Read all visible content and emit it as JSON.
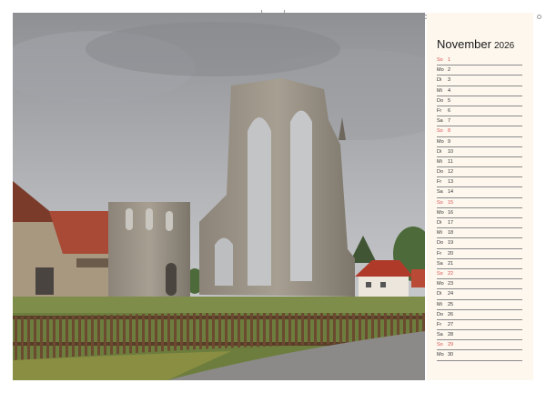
{
  "calendar": {
    "month": "November",
    "year": "2026",
    "days": [
      {
        "wd": "So",
        "d": "1",
        "sun": true
      },
      {
        "wd": "Mo",
        "d": "2"
      },
      {
        "wd": "Di",
        "d": "3"
      },
      {
        "wd": "Mi",
        "d": "4"
      },
      {
        "wd": "Do",
        "d": "5"
      },
      {
        "wd": "Fr",
        "d": "6"
      },
      {
        "wd": "Sa",
        "d": "7"
      },
      {
        "wd": "So",
        "d": "8",
        "sun": true
      },
      {
        "wd": "Mo",
        "d": "9"
      },
      {
        "wd": "Di",
        "d": "10"
      },
      {
        "wd": "Mi",
        "d": "11"
      },
      {
        "wd": "Do",
        "d": "12"
      },
      {
        "wd": "Fr",
        "d": "13"
      },
      {
        "wd": "Sa",
        "d": "14"
      },
      {
        "wd": "So",
        "d": "15",
        "sun": true
      },
      {
        "wd": "Mo",
        "d": "16"
      },
      {
        "wd": "Di",
        "d": "17"
      },
      {
        "wd": "Mi",
        "d": "18"
      },
      {
        "wd": "Do",
        "d": "19"
      },
      {
        "wd": "Fr",
        "d": "20"
      },
      {
        "wd": "Sa",
        "d": "21"
      },
      {
        "wd": "So",
        "d": "22",
        "sun": true
      },
      {
        "wd": "Mo",
        "d": "23"
      },
      {
        "wd": "Di",
        "d": "24"
      },
      {
        "wd": "Mi",
        "d": "25"
      },
      {
        "wd": "Do",
        "d": "26"
      },
      {
        "wd": "Fr",
        "d": "27"
      },
      {
        "wd": "Sa",
        "d": "28"
      },
      {
        "wd": "So",
        "d": "29",
        "sun": true
      },
      {
        "wd": "Mo",
        "d": "30"
      }
    ]
  },
  "colors": {
    "sunday": "#d9534f",
    "panel": "#fdf7ee"
  }
}
